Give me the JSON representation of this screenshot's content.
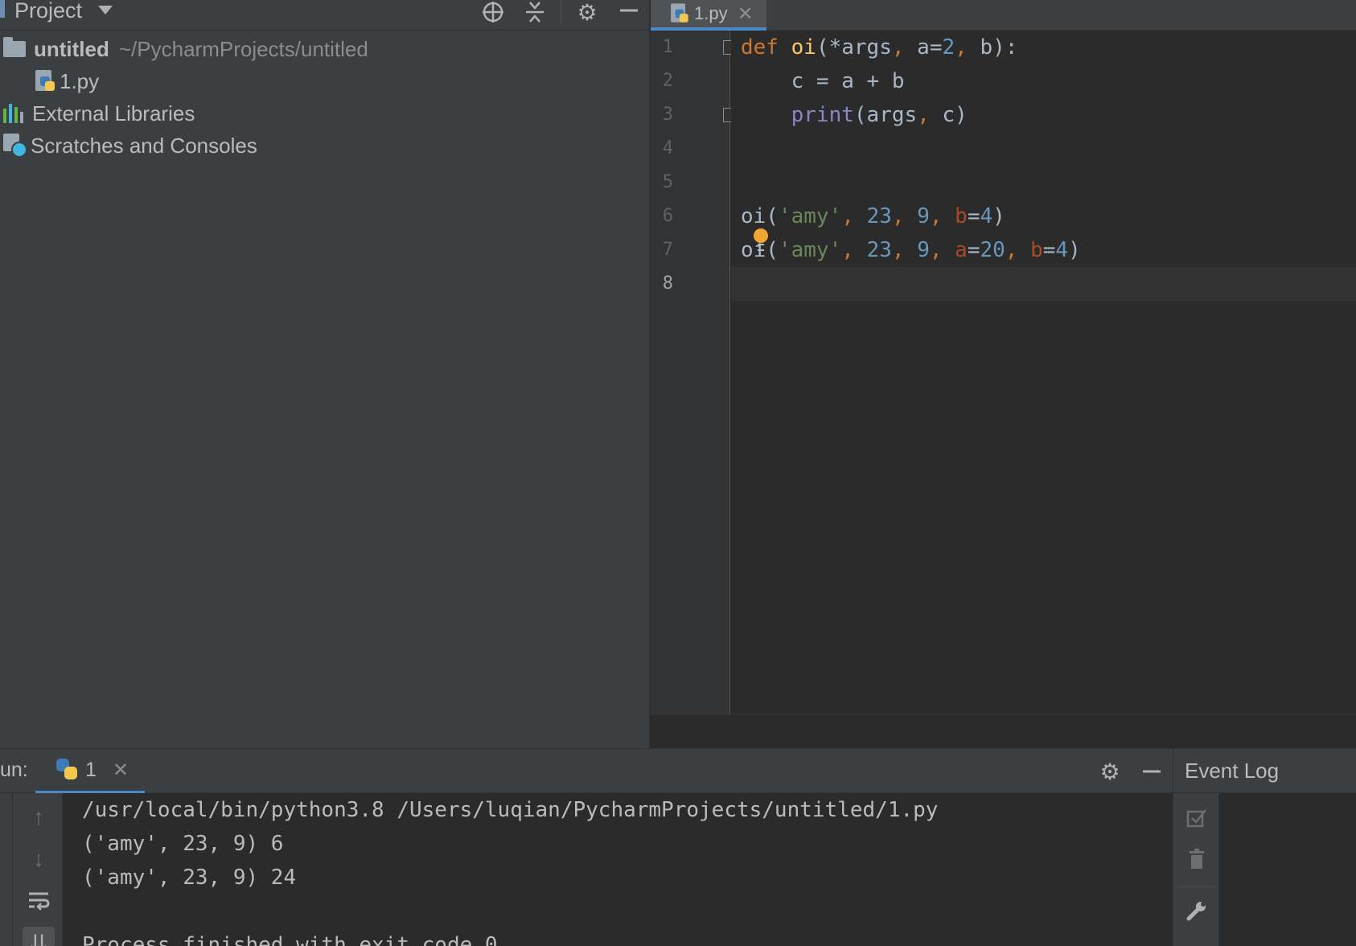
{
  "project_panel": {
    "title": "Project",
    "header_icons": [
      "crosshair-icon",
      "collapse-all-icon",
      "gear-icon",
      "minimize-icon"
    ],
    "tree": {
      "root_name": "untitled",
      "root_path": "~/PycharmProjects/untitled",
      "file_name": "1.py",
      "external_libraries": "External Libraries",
      "scratches": "Scratches and Consoles"
    }
  },
  "editor": {
    "tab_label": "1.py",
    "current_line": 8,
    "line_numbers": [
      "1",
      "2",
      "3",
      "4",
      "5",
      "6",
      "7",
      "8"
    ],
    "code": {
      "l1": "def oi(*args, a=2, b):",
      "l2": "    c = a + b",
      "l3": "    print(args, c)",
      "l6": "oi('amy', 23, 9, b=4)",
      "l7": "oi('amy', 23, 9, a=20, b=4)"
    }
  },
  "run_panel": {
    "label": "un:",
    "tab_label": "1",
    "console": [
      "/usr/local/bin/python3.8 /Users/luqian/PycharmProjects/untitled/1.py",
      "('amy', 23, 9) 6",
      "('amy', 23, 9) 24",
      "",
      "Process finished with exit code 0"
    ]
  },
  "event_log": {
    "title": "Event Log"
  },
  "colors": {
    "panel_bg": "#3c3f41",
    "editor_bg": "#2b2b2b",
    "accent": "#4a88c7",
    "keyword": "#cc7832",
    "function": "#ffc66d",
    "number": "#6897bb",
    "string": "#6a8759",
    "builtin": "#8888c6",
    "param": "#aa4926"
  }
}
